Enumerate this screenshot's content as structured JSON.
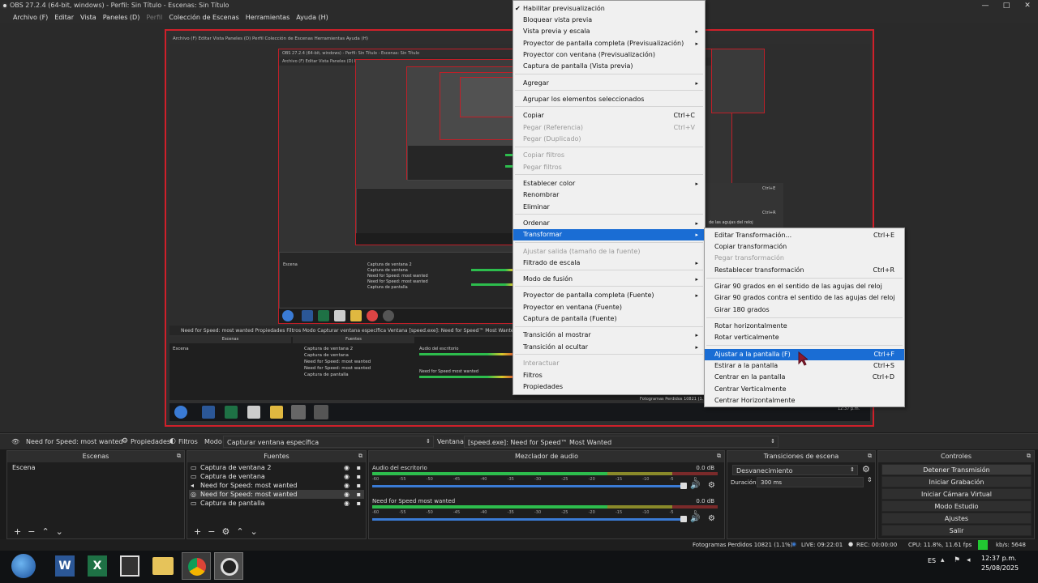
{
  "window": {
    "title": "OBS 27.2.4 (64-bit, windows) - Perfil: Sin Título - Escenas: Sin Título",
    "controls": [
      "—",
      "□",
      "✕"
    ]
  },
  "menubar": [
    "Archivo (F)",
    "Editar",
    "Vista",
    "Paneles (D)",
    "Perfil",
    "Colección de Escenas",
    "Herramientas",
    "Ayuda (H)"
  ],
  "nested_preview": {
    "title": "OBS 27.2.4 (64-bit, windows) - Perfil: Sin Título - Escenas: Sin Título",
    "menubar": "Archivo (F)   Editar   Vista   Paneles (D)   Perfil   Colección de Escenas   Herramientas   Ayuda (H)",
    "source_bar": "Need for Speed: most wanted     Propiedades    Filtros    Modo    Capturar ventana específica          Ventana    [speed.exe]: Need for Speed™ Most Wanted",
    "scenes_title": "Escenas",
    "sources_title": "Fuentes",
    "scene_item": "Escena",
    "source_items": [
      "Captura de ventana 2",
      "Captura de ventana",
      "Need for Speed: most wanted",
      "Need for Speed: most wanted",
      "Captura de pantalla"
    ],
    "mixer_items": [
      "Audio del escritorio",
      "Need for Speed  most wanted"
    ],
    "stats": "Fotogramas Perdidos 10821 (1.1%)",
    "clock": "12:37 p.m.\n25/08/2025"
  },
  "context_menu": {
    "items": [
      {
        "label": "Habilitar previsualización",
        "check": "✔",
        "disabled": false
      },
      {
        "label": "Bloquear vista previa",
        "disabled": false
      },
      {
        "label": "Vista previa y escala",
        "submenu": true
      },
      {
        "label": "Proyector de pantalla completa (Previsualización)",
        "submenu": true
      },
      {
        "label": "Proyector con ventana (Previsualización)"
      },
      {
        "label": "Captura de pantalla (Vista previa)"
      },
      {
        "label": "Agregar",
        "submenu": true
      },
      {
        "label": "Agrupar los elementos seleccionados"
      },
      {
        "label": "Copiar",
        "shortcut": "Ctrl+C"
      },
      {
        "label": "Pegar (Referencia)",
        "shortcut": "Ctrl+V",
        "disabled": true
      },
      {
        "label": "Pegar (Duplicado)",
        "disabled": true
      },
      {
        "label": "Copiar filtros",
        "disabled": true
      },
      {
        "label": "Pegar filtros",
        "disabled": true
      },
      {
        "label": "Establecer color",
        "submenu": true
      },
      {
        "label": "Renombrar"
      },
      {
        "label": "Eliminar"
      },
      {
        "label": "Ordenar",
        "submenu": true
      },
      {
        "label": "Transformar",
        "submenu": true,
        "highlighted": true
      },
      {
        "label": "Ajustar salida (tamaño de la fuente)",
        "disabled": true
      },
      {
        "label": "Filtrado de escala",
        "submenu": true
      },
      {
        "label": "Modo de fusión",
        "submenu": true
      },
      {
        "label": "Proyector de pantalla completa (Fuente)",
        "submenu": true
      },
      {
        "label": "Proyector en ventana (Fuente)"
      },
      {
        "label": "Captura de pantalla (Fuente)"
      },
      {
        "label": "Transición al mostrar",
        "submenu": true
      },
      {
        "label": "Transición al ocultar",
        "submenu": true
      },
      {
        "label": "Interactuar",
        "disabled": true
      },
      {
        "label": "Filtros"
      },
      {
        "label": "Propiedades"
      }
    ]
  },
  "transform_menu": {
    "items": [
      {
        "label": "Editar Transformación...",
        "shortcut": "Ctrl+E"
      },
      {
        "label": "Copiar transformación"
      },
      {
        "label": "Pegar transformación",
        "disabled": true
      },
      {
        "label": "Restablecer transformación",
        "shortcut": "Ctrl+R"
      },
      {
        "label": "Girar 90 grados en el sentido de las agujas del reloj"
      },
      {
        "label": "Girar 90 grados contra el sentido de las agujas del reloj"
      },
      {
        "label": "Girar 180 grados"
      },
      {
        "label": "Rotar horizontalmente"
      },
      {
        "label": "Rotar verticalmente"
      },
      {
        "label": "Ajustar a la pantalla (F)",
        "shortcut": "Ctrl+F",
        "highlighted": true
      },
      {
        "label": "Estirar a la pantalla",
        "shortcut": "Ctrl+S"
      },
      {
        "label": "Centrar en la pantalla",
        "shortcut": "Ctrl+D"
      },
      {
        "label": "Centrar Verticalmente"
      },
      {
        "label": "Centrar Horizontalmente"
      }
    ],
    "ghost_texts": [
      "Ctrl+E",
      "Ctrl+R",
      "de las agujas del reloj"
    ]
  },
  "source_toolbar": {
    "source_name": "Need for Speed: most wanted",
    "properties": "Propiedades",
    "filters": "Filtros",
    "mode_label": "Modo",
    "mode_value": "Capturar ventana específica",
    "window_label": "Ventana",
    "window_value": "[speed.exe]: Need for Speed™ Most Wanted"
  },
  "scenes": {
    "title": "Escenas",
    "items": [
      "Escena"
    ]
  },
  "sources": {
    "title": "Fuentes",
    "items": [
      {
        "label": "Captura de ventana 2",
        "icon": "monitor-icon"
      },
      {
        "label": "Captura de ventana",
        "icon": "window-icon"
      },
      {
        "label": "Need for Speed: most wanted",
        "icon": "speaker-icon"
      },
      {
        "label": "Need for Speed: most wanted",
        "icon": "gamepad-icon"
      },
      {
        "label": "Captura de pantalla",
        "icon": "monitor-icon"
      }
    ]
  },
  "mixer": {
    "title": "Mezclador de audio",
    "channels": [
      {
        "name": "Audio del escritorio",
        "db": "0.0 dB"
      },
      {
        "name": "Need for Speed  most wanted",
        "db": "0.0 dB"
      }
    ],
    "ticks": [
      "-60",
      "-55",
      "-50",
      "-45",
      "-40",
      "-35",
      "-30",
      "-25",
      "-20",
      "-15",
      "-10",
      "-5",
      "0"
    ]
  },
  "transitions": {
    "title": "Transiciones de escena",
    "value": "Desvanecimiento",
    "duration_label": "Duración",
    "duration_value": "300 ms"
  },
  "controls": {
    "title": "Controles",
    "buttons": [
      "Detener Transmisión",
      "Iniciar Grabación",
      "Iniciar Cámara Virtual",
      "Modo Estudio",
      "Ajustes",
      "Salir"
    ]
  },
  "statusbar": {
    "dropped": "Fotogramas Perdidos 10821 (1.1%)",
    "live": "LIVE: 09:22:01",
    "rec": "REC: 00:00:00",
    "cpu": "CPU: 11.8%, 11.61 fps",
    "kbps": "kb/s: 5648",
    "status_color": "#22c832"
  },
  "taskbar": {
    "lang": "ES",
    "time": "12:37 p.m.",
    "date": "25/08/2025"
  },
  "colors": {
    "accent": "#1a6dd4",
    "preview_border": "#d0202a"
  }
}
